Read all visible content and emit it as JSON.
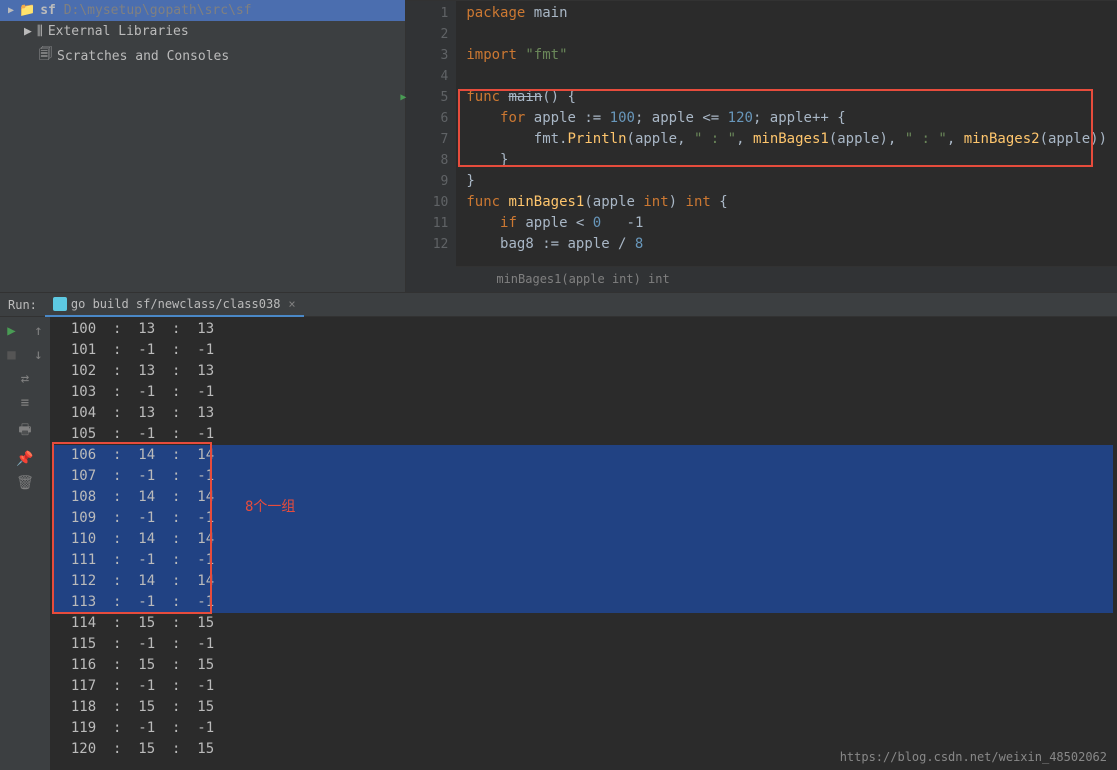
{
  "project": {
    "root_name": "sf",
    "root_path": "D:\\mysetup\\gopath\\src\\sf",
    "items": [
      {
        "icon": "lib",
        "label": "External Libraries"
      },
      {
        "icon": "scratch",
        "label": "Scratches and Consoles"
      }
    ]
  },
  "editor": {
    "breadcrumb": "minBages1(apple int) int",
    "lines": [
      {
        "num": 1,
        "tokens": [
          {
            "t": "package ",
            "c": "kw"
          },
          {
            "t": "main",
            "c": "ident"
          }
        ]
      },
      {
        "num": 2,
        "tokens": []
      },
      {
        "num": 3,
        "tokens": [
          {
            "t": "import ",
            "c": "kw"
          },
          {
            "t": "\"fmt\"",
            "c": "str"
          }
        ]
      },
      {
        "num": 4,
        "tokens": []
      },
      {
        "num": 5,
        "marker": true,
        "tokens": [
          {
            "t": "func ",
            "c": "kw"
          },
          {
            "t": "main",
            "c": "ident strike"
          },
          {
            "t": "() {",
            "c": "op"
          }
        ]
      },
      {
        "num": 6,
        "tokens": [
          {
            "t": "    for ",
            "c": "kw"
          },
          {
            "t": "apple := ",
            "c": "ident"
          },
          {
            "t": "100",
            "c": "num"
          },
          {
            "t": "; apple <= ",
            "c": "ident"
          },
          {
            "t": "120",
            "c": "num"
          },
          {
            "t": "; apple++ {",
            "c": "ident"
          }
        ]
      },
      {
        "num": 7,
        "tokens": [
          {
            "t": "        fmt.",
            "c": "ident"
          },
          {
            "t": "Println",
            "c": "fn"
          },
          {
            "t": "(apple, ",
            "c": "ident"
          },
          {
            "t": "\" : \"",
            "c": "str"
          },
          {
            "t": ", ",
            "c": "op"
          },
          {
            "t": "minBages1",
            "c": "fn"
          },
          {
            "t": "(apple), ",
            "c": "ident"
          },
          {
            "t": "\" : \"",
            "c": "str"
          },
          {
            "t": ", ",
            "c": "op"
          },
          {
            "t": "minBages2",
            "c": "fn"
          },
          {
            "t": "(apple))",
            "c": "ident"
          }
        ]
      },
      {
        "num": 8,
        "tokens": [
          {
            "t": "    }",
            "c": "op"
          }
        ]
      },
      {
        "num": 9,
        "tokens": [
          {
            "t": "}",
            "c": "op"
          }
        ]
      },
      {
        "num": 10,
        "tokens": [
          {
            "t": "func ",
            "c": "kw"
          },
          {
            "t": "minBages1",
            "c": "fn"
          },
          {
            "t": "(apple ",
            "c": "ident"
          },
          {
            "t": "int",
            "c": "kw"
          },
          {
            "t": ") ",
            "c": "op"
          },
          {
            "t": "int",
            "c": "kw"
          },
          {
            "t": " {",
            "c": "op"
          }
        ]
      },
      {
        "num": 11,
        "tokens": [
          {
            "t": "    if ",
            "c": "kw"
          },
          {
            "t": "apple < ",
            "c": "ident"
          },
          {
            "t": "0 ",
            "c": "num"
          },
          {
            "t": "  -1 ",
            "c": "ident"
          }
        ]
      },
      {
        "num": 12,
        "tokens": [
          {
            "t": "    bag8 := apple / ",
            "c": "ident"
          },
          {
            "t": "8",
            "c": "num"
          }
        ]
      }
    ]
  },
  "run": {
    "label": "Run:",
    "tab_name": "go build sf/newclass/class038",
    "toolbar_icons": [
      "play",
      "up",
      "stop",
      "down",
      "wrap",
      "filter",
      "print",
      "pin",
      "trash"
    ],
    "output": [
      {
        "a": "100",
        "b": "13",
        "c": "13",
        "hl": false
      },
      {
        "a": "101",
        "b": "-1",
        "c": "-1",
        "hl": false
      },
      {
        "a": "102",
        "b": "13",
        "c": "13",
        "hl": false
      },
      {
        "a": "103",
        "b": "-1",
        "c": "-1",
        "hl": false
      },
      {
        "a": "104",
        "b": "13",
        "c": "13",
        "hl": false
      },
      {
        "a": "105",
        "b": "-1",
        "c": "-1",
        "hl": false
      },
      {
        "a": "106",
        "b": "14",
        "c": "14",
        "hl": true
      },
      {
        "a": "107",
        "b": "-1",
        "c": "-1",
        "hl": true
      },
      {
        "a": "108",
        "b": "14",
        "c": "14",
        "hl": true
      },
      {
        "a": "109",
        "b": "-1",
        "c": "-1",
        "hl": true
      },
      {
        "a": "110",
        "b": "14",
        "c": "14",
        "hl": true
      },
      {
        "a": "111",
        "b": "-1",
        "c": "-1",
        "hl": true
      },
      {
        "a": "112",
        "b": "14",
        "c": "14",
        "hl": true
      },
      {
        "a": "113",
        "b": "-1",
        "c": "-1",
        "hl": true
      },
      {
        "a": "114",
        "b": "15",
        "c": "15",
        "hl": false
      },
      {
        "a": "115",
        "b": "-1",
        "c": "-1",
        "hl": false
      },
      {
        "a": "116",
        "b": "15",
        "c": "15",
        "hl": false
      },
      {
        "a": "117",
        "b": "-1",
        "c": "-1",
        "hl": false
      },
      {
        "a": "118",
        "b": "15",
        "c": "15",
        "hl": false
      },
      {
        "a": "119",
        "b": "-1",
        "c": "-1",
        "hl": false
      },
      {
        "a": "120",
        "b": "15",
        "c": "15",
        "hl": false
      }
    ],
    "annotation": "8个一组"
  },
  "watermark": "https://blog.csdn.net/weixin_48502062"
}
